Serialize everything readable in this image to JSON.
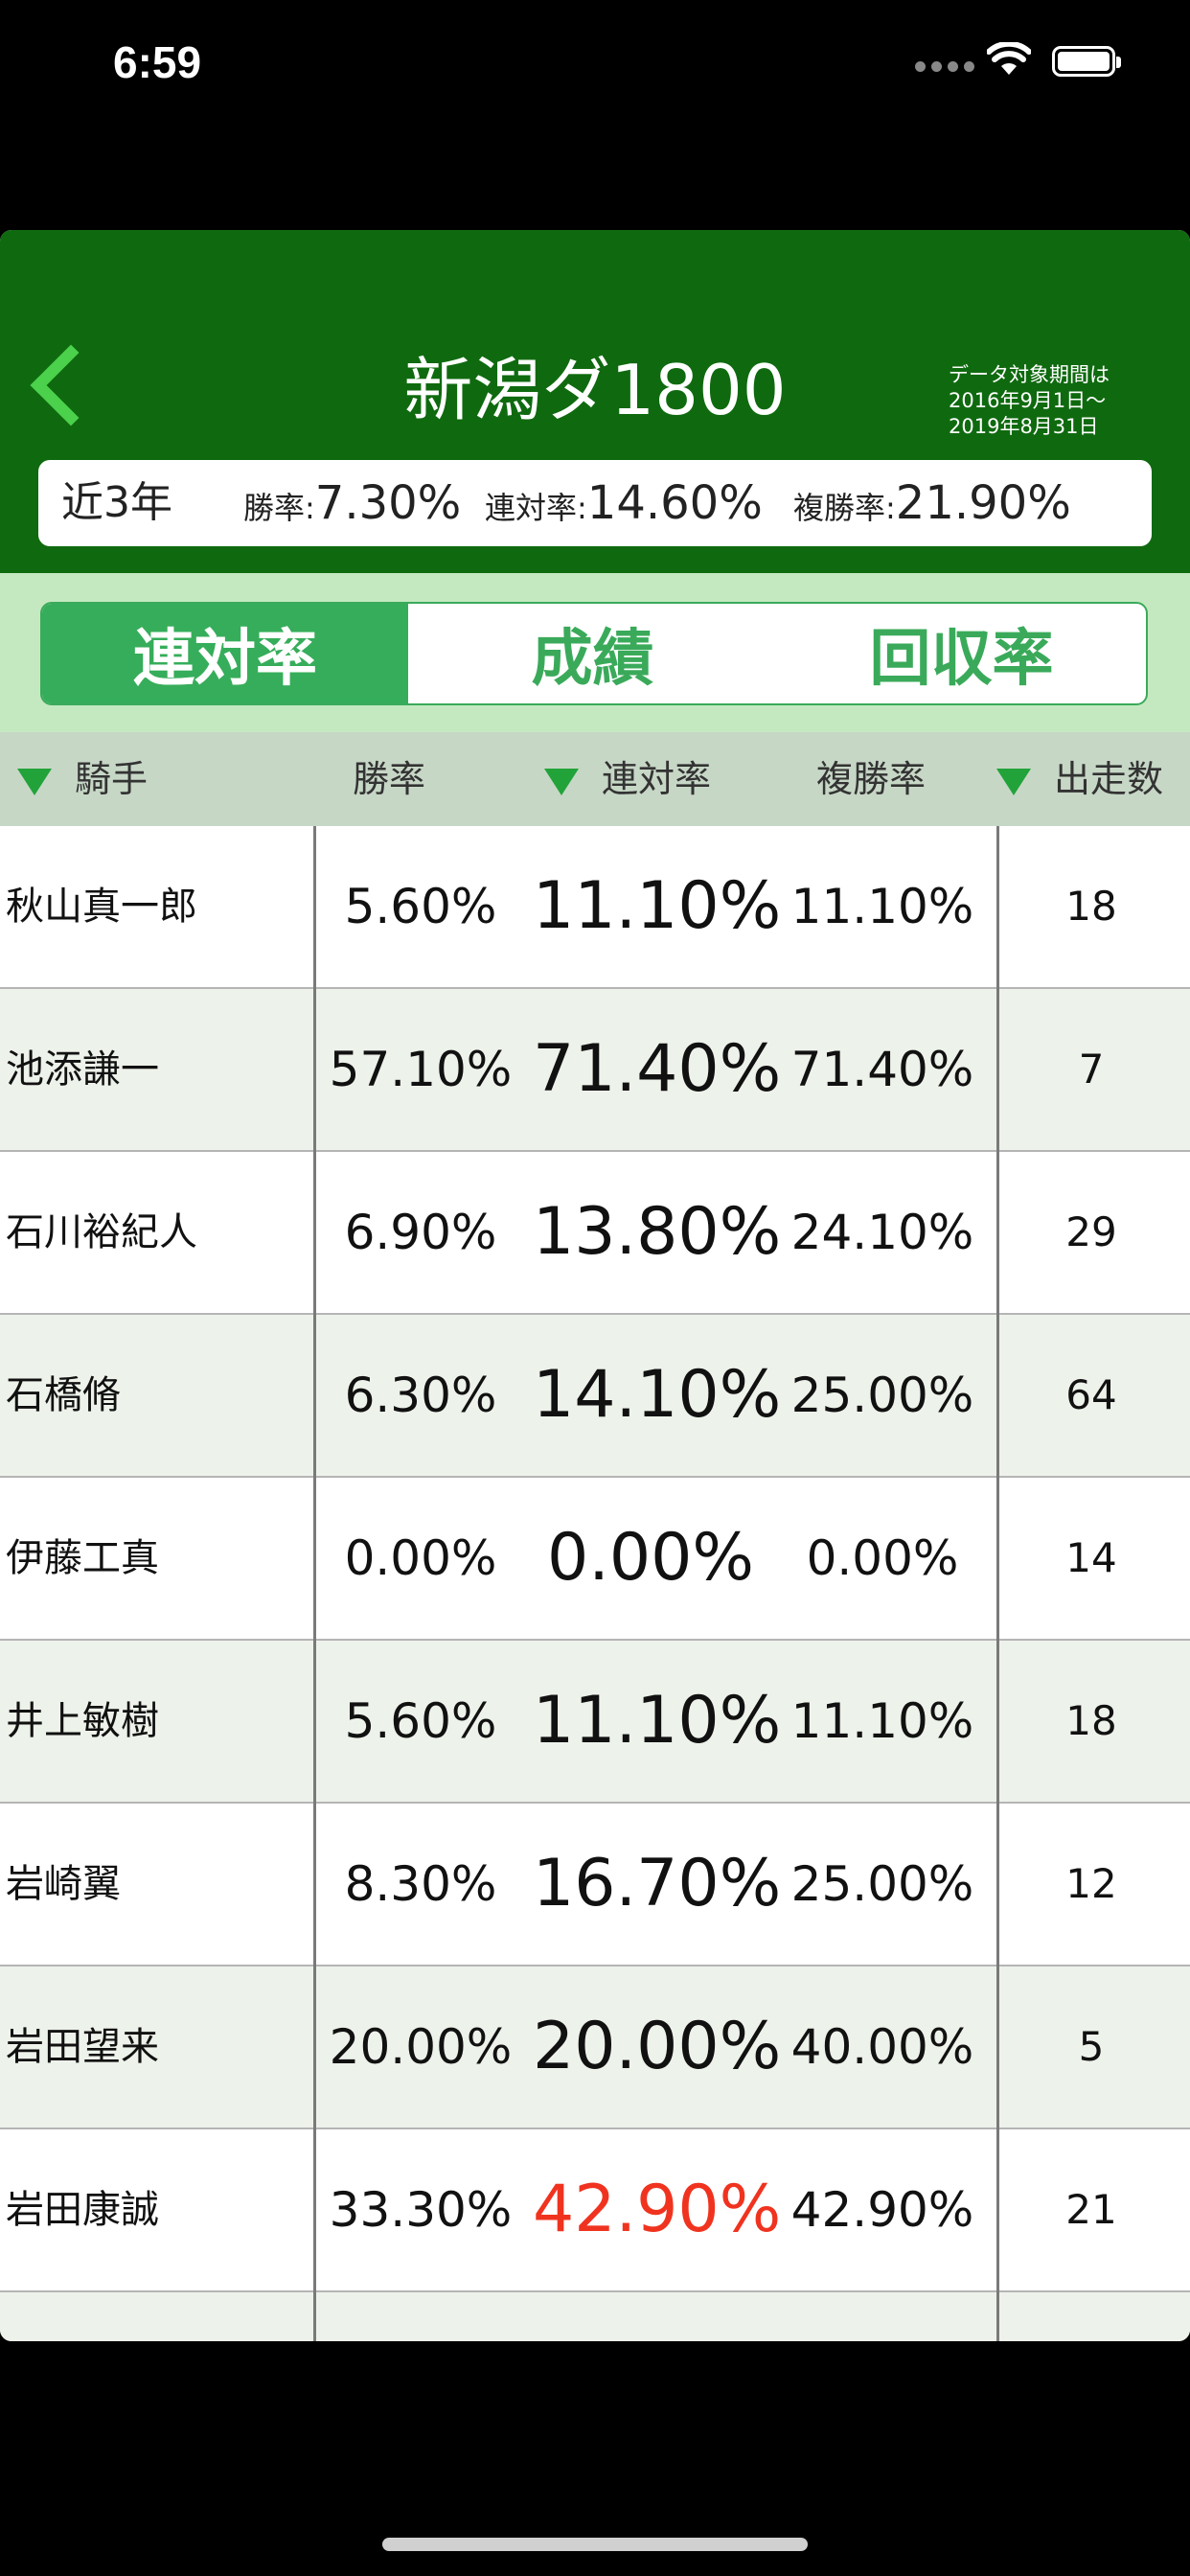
{
  "status_bar": {
    "time": "6:59"
  },
  "header": {
    "title": "新潟ダ1800",
    "period_line1": "データ対象期間は",
    "period_line2": "2016年9月1日〜",
    "period_line3": "2019年8月31日"
  },
  "summary": {
    "range": "近3年",
    "win_label": "勝率:",
    "win_value": "7.30%",
    "ren_label": "連対率:",
    "ren_value": "14.60%",
    "fuku_label": "複勝率:",
    "fuku_value": "21.90%"
  },
  "segments": [
    {
      "label": "連対率",
      "active": true
    },
    {
      "label": "成績",
      "active": false
    },
    {
      "label": "回収率",
      "active": false
    }
  ],
  "columns": {
    "jockey": "騎手",
    "win": "勝率",
    "ren": "連対率",
    "fuku": "複勝率",
    "runs": "出走数"
  },
  "rows": [
    {
      "name": "秋山真一郎",
      "win": "5.60%",
      "ren": "11.10%",
      "fuku": "11.10%",
      "runs": "18"
    },
    {
      "name": "池添謙一",
      "win": "57.10%",
      "ren": "71.40%",
      "fuku": "71.40%",
      "runs": "7"
    },
    {
      "name": "石川裕紀人",
      "win": "6.90%",
      "ren": "13.80%",
      "fuku": "24.10%",
      "runs": "29"
    },
    {
      "name": "石橋脩",
      "win": "6.30%",
      "ren": "14.10%",
      "fuku": "25.00%",
      "runs": "64"
    },
    {
      "name": "伊藤工真",
      "win": "0.00%",
      "ren": "0.00%",
      "fuku": "0.00%",
      "runs": "14"
    },
    {
      "name": "井上敏樹",
      "win": "5.60%",
      "ren": "11.10%",
      "fuku": "11.10%",
      "runs": "18"
    },
    {
      "name": "岩崎翼",
      "win": "8.30%",
      "ren": "16.70%",
      "fuku": "25.00%",
      "runs": "12"
    },
    {
      "name": "岩田望来",
      "win": "20.00%",
      "ren": "20.00%",
      "fuku": "40.00%",
      "runs": "5"
    },
    {
      "name": "岩田康誠",
      "win": "33.30%",
      "ren": "42.90%",
      "fuku": "42.90%",
      "runs": "21"
    }
  ],
  "colors": {
    "header_bg": "#0f6a0f",
    "accent_green": "#36ad5a",
    "highlight_red": "#f0331f",
    "segment_area_bg": "#c4e9c1",
    "column_header_bg": "#c7d7c6",
    "alt_row_bg": "#edf2ea"
  },
  "icons": {
    "back": "chevron-left-icon",
    "sort": "sort-triangle-icon",
    "wifi": "wifi-icon",
    "battery": "battery-icon",
    "signal": "signal-dots-icon"
  }
}
